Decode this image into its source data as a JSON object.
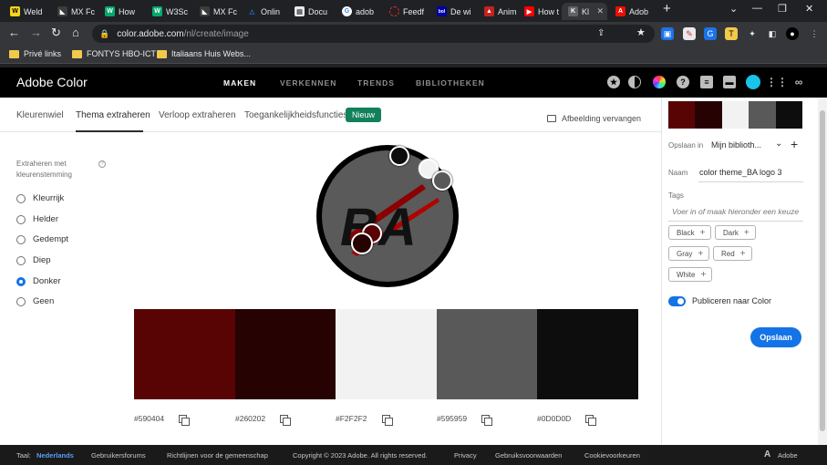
{
  "browser": {
    "tabs": [
      {
        "title": "Weld",
        "icon": "yellow-w-icon",
        "color": "#f7d51d"
      },
      {
        "title": "MX Fc",
        "icon": "mx-icon",
        "color": "#3c3c3c"
      },
      {
        "title": "How",
        "icon": "green-w-icon",
        "color": "#04aa6d"
      },
      {
        "title": "W3Sc",
        "icon": "green-w-icon",
        "color": "#04aa6d"
      },
      {
        "title": "MX Fc",
        "icon": "mx-icon",
        "color": "#3c3c3c"
      },
      {
        "title": "Onlin",
        "icon": "triangle-icon",
        "color": "#1a73e8"
      },
      {
        "title": "Docu",
        "icon": "document-icon",
        "color": "#e8eaed"
      },
      {
        "title": "adob",
        "icon": "google-icon",
        "color": "#ffffff"
      },
      {
        "title": "Feedf",
        "icon": "feedback-icon",
        "color": "#d93025"
      },
      {
        "title": "De wi",
        "icon": "bol-icon",
        "color": "#0000a4"
      },
      {
        "title": "Anim",
        "icon": "anim-icon",
        "color": "#c5221f"
      },
      {
        "title": "How t",
        "icon": "youtube-icon",
        "color": "#ff0000"
      },
      {
        "title": "Kl",
        "icon": "k-icon",
        "color": "#5f6368"
      },
      {
        "title": "Adob",
        "icon": "adobe-icon",
        "color": "#eb1000"
      }
    ],
    "url_host": "color.adobe.com",
    "url_path": "/nl/create/image",
    "bookmarks": [
      "Privé links",
      "FONTYS HBO-ICT",
      "Italiaans Huis Webs..."
    ]
  },
  "adobe_header": {
    "brand": "Adobe Color",
    "nav": [
      "MAKEN",
      "VERKENNEN",
      "TRENDS",
      "BIBLIOTHEKEN"
    ],
    "active_nav": "MAKEN"
  },
  "subnav": {
    "tabs": [
      "Kleurenwiel",
      "Thema extraheren",
      "Verloop extraheren",
      "Toegankelijkheidsfuncties"
    ],
    "new_badge": "Nieuw",
    "replace_image": "Afbeelding vervangen"
  },
  "mood": {
    "title": "Extraheren met kleurenstemming",
    "options": [
      "Kleurrijk",
      "Helder",
      "Gedempt",
      "Diep",
      "Donker",
      "Geen"
    ],
    "selected": "Donker"
  },
  "logo_text": "BA",
  "palette": [
    {
      "hex": "#590404"
    },
    {
      "hex": "#260202"
    },
    {
      "hex": "#F2F2F2"
    },
    {
      "hex": "#595959"
    },
    {
      "hex": "#0D0D0D"
    }
  ],
  "panel": {
    "save_in_label": "Opslaan in",
    "save_in_value": "Mijn biblioth...",
    "name_label": "Naam",
    "name_value": "color theme_BA logo 3",
    "tags_label": "Tags",
    "tags_placeholder": "Voer in of maak hieronder een keuze",
    "tags": [
      "Black",
      "Dark",
      "Gray",
      "Red",
      "White"
    ],
    "publish_label": "Publiceren naar Color",
    "publish_on": true,
    "save_button": "Opslaan"
  },
  "footer": {
    "lang_label": "Taal:",
    "lang_value": "Nederlands",
    "links": [
      "Gebruikersforums",
      "Richtlijnen voor de gemeenschap",
      "Copyright © 2023 Adobe. All rights reserved.",
      "Privacy",
      "Gebruiksvoorwaarden",
      "Cookievoorkeuren"
    ],
    "adobe": "Adobe"
  }
}
